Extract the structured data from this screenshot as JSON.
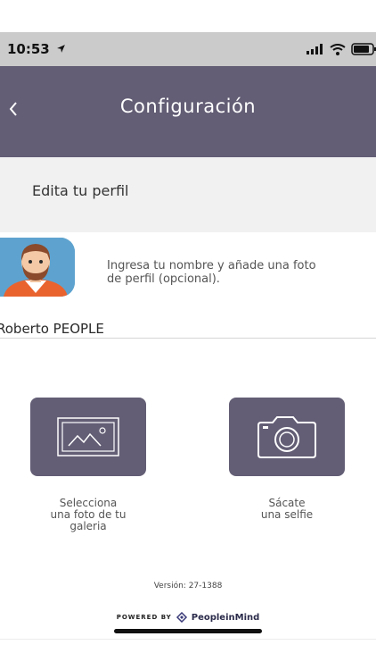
{
  "status": {
    "time": "10:53"
  },
  "nav": {
    "title": "Configuración"
  },
  "section": {
    "title": "Edita tu perfil"
  },
  "profile": {
    "hint": "Ingresa tu nombre y añade una foto\nde perfil (opcional).",
    "name": "Roberto PEOPLE"
  },
  "actions": {
    "gallery_label": "Selecciona\nuna foto de tu\ngaleria",
    "camera_label": "Sácate\nuna selfie"
  },
  "footer": {
    "version": "Versión: 27-1388",
    "powered_by": "POWERED BY",
    "brand": "PeopleinMind"
  },
  "colors": {
    "accent": "#635d75",
    "header_bg": "#f1f1f1",
    "status_bg": "#cbcbcb"
  },
  "icons": [
    "location-arrow-icon",
    "signal-icon",
    "wifi-icon",
    "battery-icon",
    "back-chevron-icon",
    "image-gallery-icon",
    "camera-icon",
    "brand-logo-icon"
  ]
}
